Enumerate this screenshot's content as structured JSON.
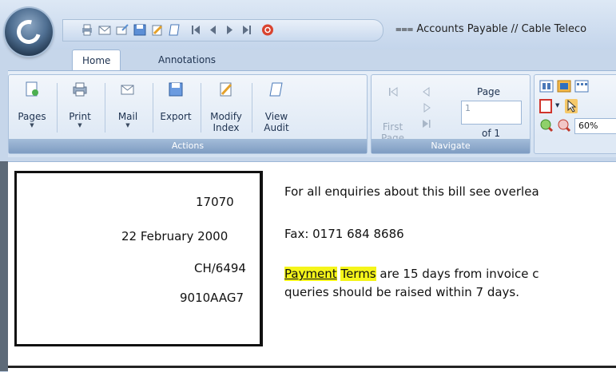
{
  "window": {
    "title": "Accounts Payable // Cable Teleco",
    "title_prefix": "⩶"
  },
  "tabs": [
    {
      "label": "Home",
      "active": true
    },
    {
      "label": "Annotations",
      "active": false
    }
  ],
  "ribbon": {
    "actions": {
      "label": "Actions",
      "buttons": {
        "pages": "Pages",
        "print": "Print",
        "mail": "Mail",
        "export": "Export",
        "modify_index_1": "Modify",
        "modify_index_2": "Index",
        "view_audit_1": "View",
        "view_audit_2": "Audit"
      }
    },
    "navigate": {
      "label": "Navigate",
      "first_page_1": "First",
      "first_page_2": "Page",
      "page_label": "Page",
      "page_value": "1",
      "of_label": "of 1"
    },
    "view": {
      "zoom_value": "60%"
    }
  },
  "document": {
    "box_lines": [
      "17070",
      "22 February 2000",
      "CH/6494",
      "9010AAG7"
    ],
    "enquiries": "For all enquiries about this bill see overlea",
    "fax": "Fax: 0171 684 8686",
    "terms_hl1": "Payment",
    "terms_hl2": "Terms",
    "terms_rest": " are 15 days from invoice c",
    "terms_line2": "queries should be raised within 7 days."
  },
  "colors": {
    "ribbon_group_label": "#7e9cc2",
    "highlight": "#f5f51a",
    "close_button": "#d9432f"
  },
  "icons": [
    "printer-icon",
    "mail-icon",
    "send-mail-icon",
    "save-icon",
    "modify-index-icon",
    "view-audit-icon",
    "first-page-icon",
    "previous-page-icon",
    "next-page-icon",
    "last-page-icon",
    "stop-icon"
  ]
}
